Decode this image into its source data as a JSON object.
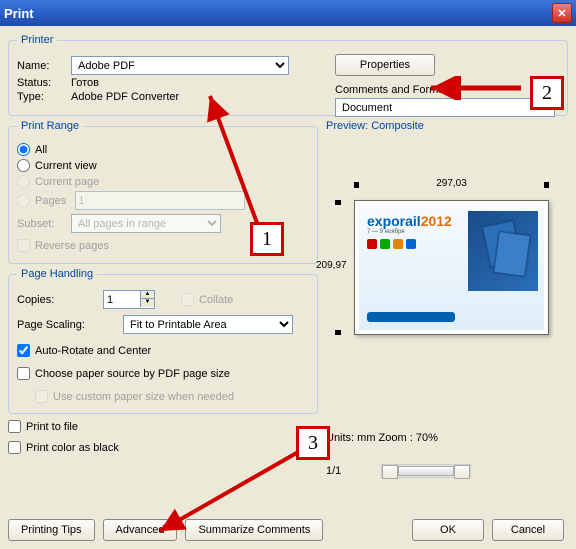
{
  "window": {
    "title": "Print"
  },
  "printer": {
    "legend": "Printer",
    "name_label": "Name:",
    "name_value": "Adobe PDF",
    "status_label": "Status:",
    "status_value": "Готов",
    "type_label": "Type:",
    "type_value": "Adobe PDF Converter",
    "properties_button": "Properties",
    "comments_forms_label": "Comments and Forms:",
    "comments_forms_value": "Document"
  },
  "print_range": {
    "legend": "Print Range",
    "all": "All",
    "current_view": "Current view",
    "current_page": "Current page",
    "pages": "Pages",
    "pages_value": "1",
    "subset_label": "Subset:",
    "subset_value": "All pages in range",
    "reverse_pages": "Reverse pages"
  },
  "page_handling": {
    "legend": "Page Handling",
    "copies_label": "Copies:",
    "copies_value": "1",
    "collate": "Collate",
    "page_scaling_label": "Page Scaling:",
    "page_scaling_value": "Fit to Printable Area",
    "auto_rotate": "Auto-Rotate and Center",
    "choose_paper": "Choose paper source by PDF page size",
    "use_custom": "Use custom paper size when needed"
  },
  "misc": {
    "print_to_file": "Print to file",
    "print_color_black": "Print color as black"
  },
  "preview": {
    "title": "Preview: Composite",
    "width": "297,03",
    "height": "209,97",
    "units_zoom": "Units: mm Zoom :   70%",
    "page_indicator": "1/1",
    "logo_main": "exporail",
    "logo_year": "2012"
  },
  "buttons": {
    "printing_tips": "Printing Tips",
    "advanced": "Advanced",
    "summarize": "Summarize Comments",
    "ok": "OK",
    "cancel": "Cancel"
  },
  "callouts": {
    "c1": "1",
    "c2": "2",
    "c3": "3"
  }
}
